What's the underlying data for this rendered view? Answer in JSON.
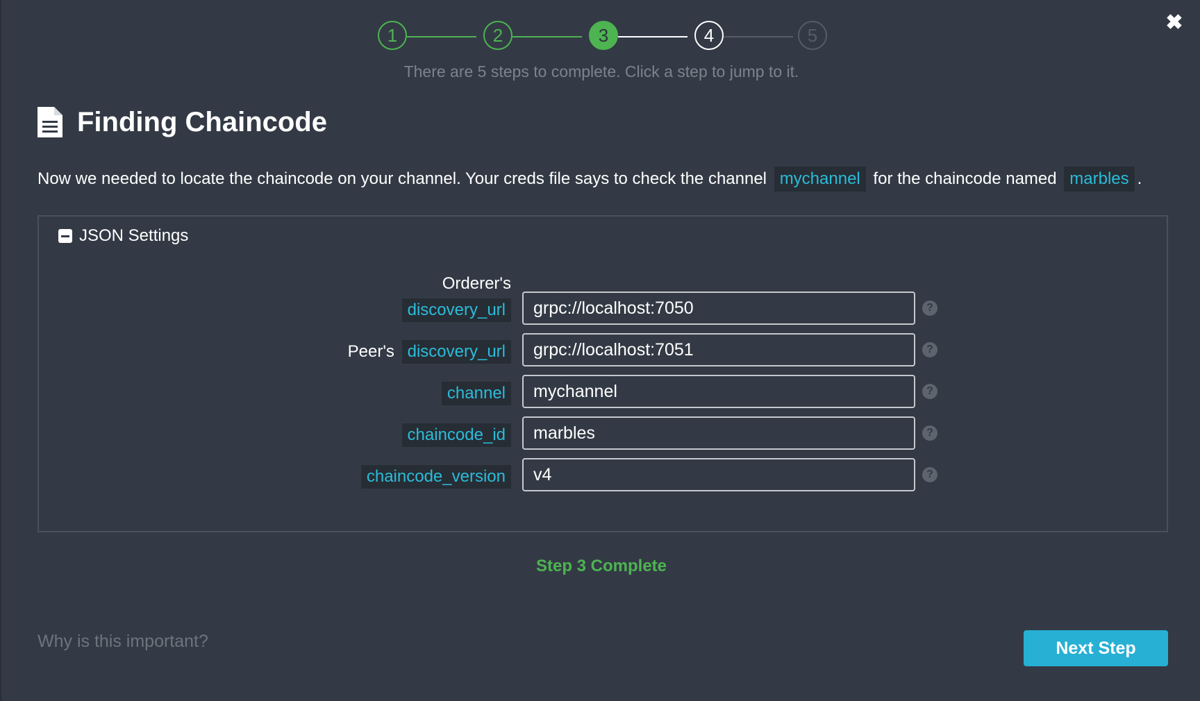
{
  "dialog": {
    "close_icon": "close-icon"
  },
  "stepper": {
    "steps": [
      {
        "label": "1",
        "state": "done"
      },
      {
        "label": "2",
        "state": "done"
      },
      {
        "label": "3",
        "state": "active"
      },
      {
        "label": "4",
        "state": "next"
      },
      {
        "label": "5",
        "state": "future"
      }
    ],
    "hint": "There are 5 steps to complete. Click a step to jump to it."
  },
  "heading": {
    "title": "Finding Chaincode",
    "icon": "document-icon"
  },
  "description": {
    "part1": "Now we needed to locate the chaincode on your channel. Your creds file says to check the channel",
    "channel": "mychannel",
    "part2": "for the chaincode named",
    "chaincode": "marbles",
    "part3": "."
  },
  "settings": {
    "toggle_label": "JSON Settings",
    "rows": [
      {
        "prefix": "Orderer's",
        "key": "discovery_url",
        "value": "grpc://localhost:7050"
      },
      {
        "prefix": "Peer's",
        "key": "discovery_url",
        "value": "grpc://localhost:7051"
      },
      {
        "prefix": "",
        "key": "channel",
        "value": "mychannel"
      },
      {
        "prefix": "",
        "key": "chaincode_id",
        "value": "marbles"
      },
      {
        "prefix": "",
        "key": "chaincode_version",
        "value": "v4"
      }
    ],
    "help_symbol": "?"
  },
  "status": "Step 3 Complete",
  "footer": {
    "why_link": "Why is this important?",
    "next_button": "Next Step"
  },
  "colors": {
    "background": "#333a45",
    "success_green": "#4db451",
    "code_cyan": "#2bbcd9",
    "button_blue": "#27b0d4"
  }
}
